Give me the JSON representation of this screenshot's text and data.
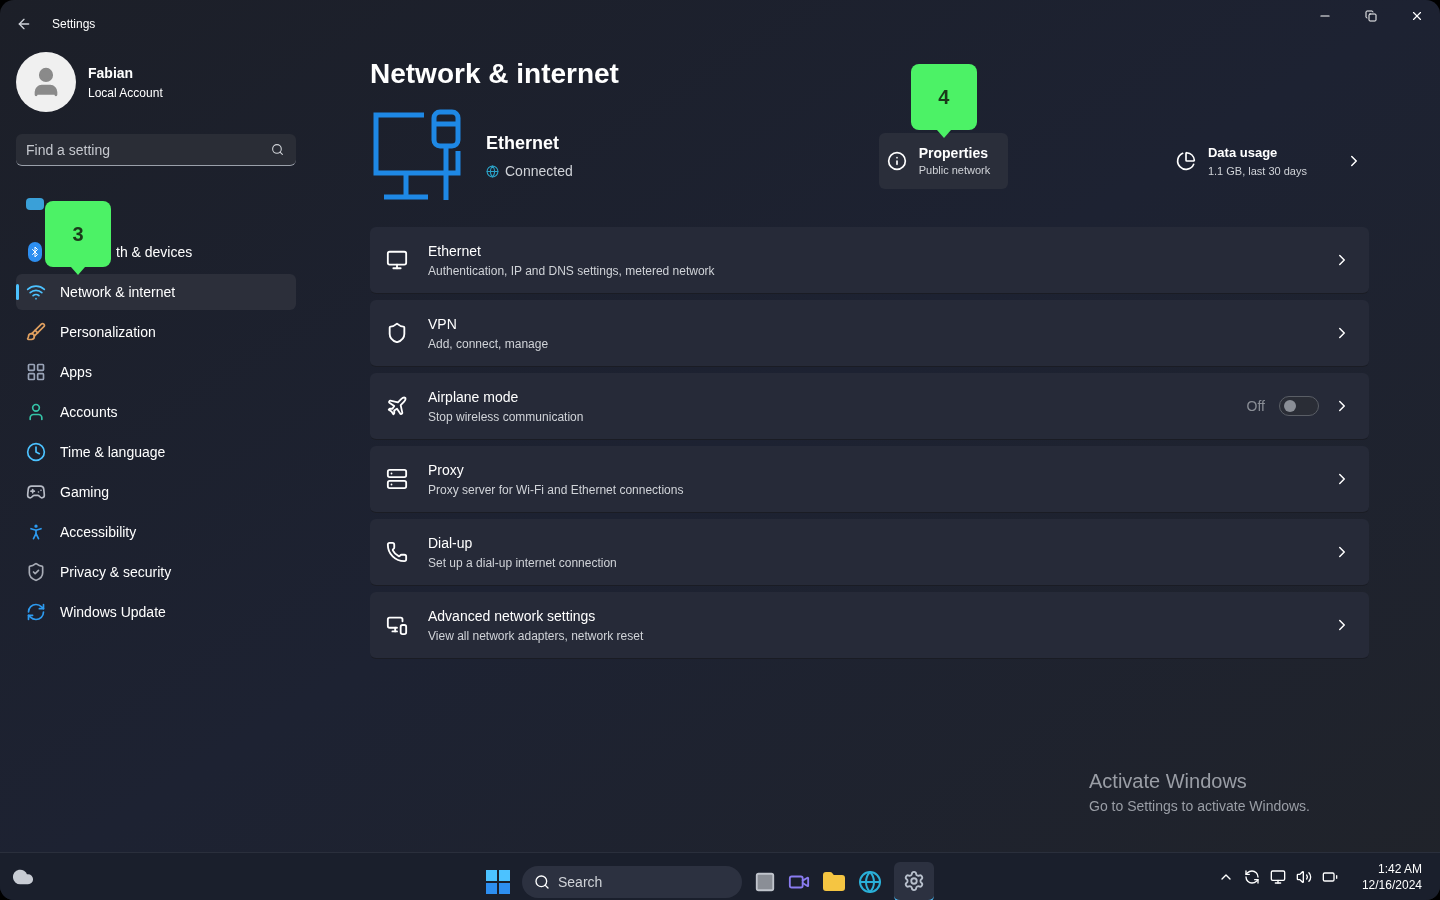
{
  "window": {
    "title": "Settings"
  },
  "account": {
    "name": "Fabian",
    "type": "Local Account"
  },
  "search": {
    "placeholder": "Find a setting"
  },
  "sidebar": {
    "items": [
      {
        "selected": false
      },
      {
        "label": "th & devices",
        "clipped": true,
        "selected": false
      },
      {
        "label": "Network & internet",
        "selected": true
      },
      {
        "label": "Personalization",
        "selected": false
      },
      {
        "label": "Apps",
        "selected": false
      },
      {
        "label": "Accounts",
        "selected": false
      },
      {
        "label": "Time & language",
        "selected": false
      },
      {
        "label": "Gaming",
        "selected": false
      },
      {
        "label": "Accessibility",
        "selected": false
      },
      {
        "label": "Privacy & security",
        "selected": false
      },
      {
        "label": "Windows Update",
        "selected": false
      }
    ]
  },
  "page": {
    "title": "Network & internet",
    "connection": {
      "name": "Ethernet",
      "status": "Connected"
    },
    "properties": {
      "title": "Properties",
      "subtitle": "Public network"
    },
    "data_usage": {
      "title": "Data usage",
      "subtitle": "1.1 GB, last 30 days"
    },
    "rows": [
      {
        "kind": "link",
        "title": "Ethernet",
        "subtitle": "Authentication, IP and DNS settings, metered network"
      },
      {
        "kind": "link",
        "title": "VPN",
        "subtitle": "Add, connect, manage"
      },
      {
        "kind": "toggle",
        "title": "Airplane mode",
        "subtitle": "Stop wireless communication",
        "state_label": "Off",
        "on": false
      },
      {
        "kind": "link",
        "title": "Proxy",
        "subtitle": "Proxy server for Wi-Fi and Ethernet connections"
      },
      {
        "kind": "link",
        "title": "Dial-up",
        "subtitle": "Set up a dial-up internet connection"
      },
      {
        "kind": "link",
        "title": "Advanced network settings",
        "subtitle": "View all network adapters, network reset"
      }
    ]
  },
  "callouts": [
    {
      "label": "3"
    },
    {
      "label": "4"
    }
  ],
  "activation": {
    "title": "Activate Windows",
    "message": "Go to Settings to activate Windows."
  },
  "taskbar": {
    "search_placeholder": "Search",
    "time": "1:42 AM",
    "date": "12/16/2024"
  }
}
